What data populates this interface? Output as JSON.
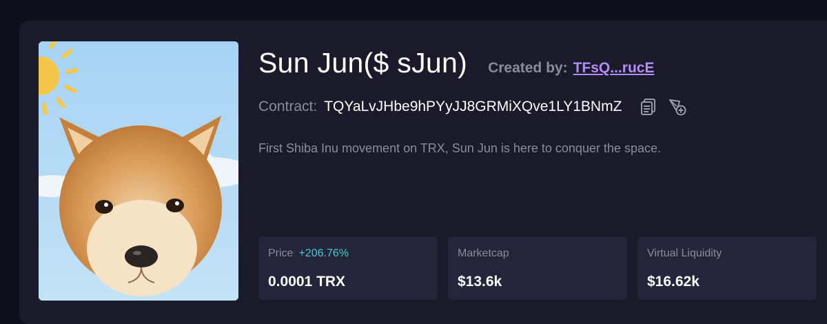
{
  "token": {
    "name": "Sun Jun($ sJun)",
    "created_by_label": "Created by:",
    "creator": "TFsQ...rucE",
    "contract_label": "Contract:",
    "contract_address": "TQYaLvJHbe9hPYyJJ8GRMiXQve1LY1BNmZ",
    "description": "First Shiba Inu movement on TRX, Sun Jun is here to conquer the space."
  },
  "icons": {
    "copy": "copy-icon",
    "add_wallet": "add-to-wallet-icon",
    "image": "shiba-inu-puppy-image"
  },
  "stats": {
    "price": {
      "label": "Price",
      "change": "+206.76%",
      "value": "0.0001 TRX"
    },
    "marketcap": {
      "label": "Marketcap",
      "value": "$13.6k"
    },
    "liquidity": {
      "label": "Virtual Liquidity",
      "value": "$16.62k"
    }
  },
  "colors": {
    "background": "#0f0f1c",
    "card": "#1a1a2a",
    "stat_card": "#24253a",
    "link": "#b48cf5",
    "positive_change": "#48c9d4",
    "muted_text": "#8a8c9c"
  }
}
